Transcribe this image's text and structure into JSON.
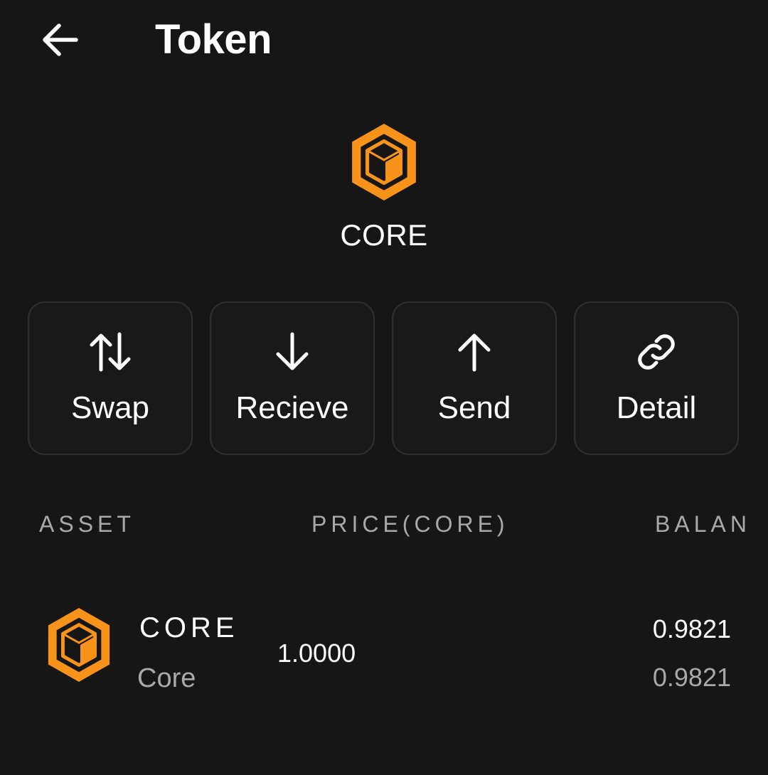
{
  "header": {
    "title": "Token"
  },
  "token": {
    "symbol": "CORE",
    "brand_color": "#F7931A"
  },
  "actions": [
    {
      "label": "Swap",
      "icon": "swap-arrows-icon"
    },
    {
      "label": "Recieve",
      "icon": "arrow-down-icon"
    },
    {
      "label": "Send",
      "icon": "arrow-up-icon"
    },
    {
      "label": "Detail",
      "icon": "link-icon"
    }
  ],
  "table": {
    "columns": [
      "ASSET",
      "PRICE(CORE)",
      "BALAN"
    ],
    "rows": [
      {
        "symbol": "CORE",
        "name": "Core",
        "price": "1.0000",
        "balance": "0.9821",
        "balance_sub": "0.9821"
      }
    ]
  },
  "colors": {
    "background": "#161616",
    "card_border": "#2f2f2f",
    "muted_text": "#a9a9a9",
    "accent": "#F7931A"
  }
}
